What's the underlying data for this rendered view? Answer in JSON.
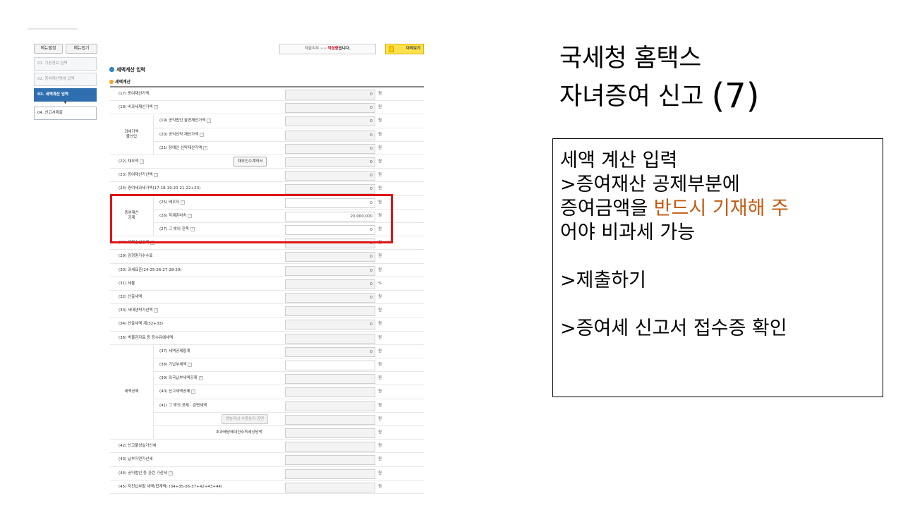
{
  "sidebar": {
    "menu_expand": "메뉴펼침",
    "menu_collapse": "메뉴접기",
    "steps": [
      {
        "label": "01. 기본정보 입력",
        "state": "done"
      },
      {
        "label": "02. 증여재산명세 입력",
        "state": "done"
      },
      {
        "label": "03. 세액계산 입력",
        "state": "active"
      },
      {
        "label": "04. 신고서제출",
        "state": "pending"
      }
    ]
  },
  "topbar": {
    "status_prefix": "제출여부 ›››› ",
    "status_value": "작성중",
    "status_suffix": "입니다.",
    "preview_button": "미리보기"
  },
  "section": {
    "title": "세액계산 입력",
    "subtitle": "세액계산"
  },
  "groups": {
    "g1": "과세가액\n불산입",
    "g2": "증여재산\n공제",
    "g3": "세액공제"
  },
  "rows": [
    {
      "label": "(17) 증여재산가액",
      "value": "0",
      "unit": "원"
    },
    {
      "label": "(18) 비과세재산가액",
      "value": "0",
      "unit": "원",
      "help": true
    },
    {
      "label": "(19) 공익법인 출연재산가액",
      "value": "0",
      "unit": "원",
      "help": true
    },
    {
      "label": "(20) 공익신탁 재산가액",
      "value": "0",
      "unit": "원",
      "help": true
    },
    {
      "label": "(21) 장애인 신탁재산가액",
      "value": "0",
      "unit": "원",
      "help": true
    },
    {
      "label": "(22) 채무액",
      "value": "0",
      "unit": "원",
      "help": true,
      "button": "채무인수계약서"
    },
    {
      "label": "(23) 증여재산가산액",
      "value": "0",
      "unit": "원",
      "help": true
    },
    {
      "label": "(24) 증여세과세가액(17-18-19-20-21-22+23)",
      "value": "0",
      "unit": "원"
    },
    {
      "label": "(25) 배우자",
      "value": "0",
      "unit": "원",
      "help": true
    },
    {
      "label": "(26) 직계존비속",
      "value": "20,000,000",
      "unit": "원",
      "help": true
    },
    {
      "label": "(27) 그 밖의 친족",
      "value": "0",
      "unit": "원",
      "help": true
    },
    {
      "label": "(28) 재해손실공제",
      "value": "0",
      "unit": "원",
      "help": true
    },
    {
      "label": "(29) 감정평가수수료",
      "value": "0",
      "unit": "원"
    },
    {
      "label": "(30) 과세표준(24-25-26-27-28-29)",
      "value": "0",
      "unit": "원"
    },
    {
      "label": "(31) 세율",
      "value": "0",
      "unit": "%"
    },
    {
      "label": "(32) 산출세액",
      "value": "0",
      "unit": "원"
    },
    {
      "label": "(33) 세대생략가산액",
      "value": "",
      "unit": "원",
      "help": true
    },
    {
      "label": "(34) 산출세액 계(32+33)",
      "value": "0",
      "unit": "원"
    },
    {
      "label": "(36) 박물관자료 등 징수유예세액",
      "value": "",
      "unit": "원"
    },
    {
      "label": "(37) 세액공제합계",
      "value": "0",
      "unit": "원"
    },
    {
      "label": "(38) 기납부세액",
      "value": "",
      "unit": "원",
      "help": true
    },
    {
      "label": "(39) 외국납부세액공제",
      "value": "",
      "unit": "원",
      "help": true
    },
    {
      "label": "(40) 신고세액공제",
      "value": "",
      "unit": "원",
      "help": true
    },
    {
      "label": "(41) 그 밖의 공제 · 감면세액",
      "value": "",
      "unit": "원"
    },
    {
      "label": "",
      "value": "",
      "unit": "원",
      "button": "영농자녀 수증농지 감면"
    },
    {
      "label": "초과배당에대한소득세상당액",
      "value": "",
      "unit": "원"
    },
    {
      "label": "(42) 신고불성실가산세",
      "value": "",
      "unit": "원"
    },
    {
      "label": "(43) 납부지연가산세",
      "value": "",
      "unit": "원"
    },
    {
      "label": "(44) 공익법인 등 관련 가산세",
      "value": "",
      "unit": "원",
      "help": true
    },
    {
      "label": "(45) 자진납부할 세액(합계액) (34+35-36-37+42+43+44)",
      "value": "",
      "unit": "원"
    }
  ],
  "panel": {
    "title_line1": "국세청 홈택스",
    "title_line2": "자녀증여 신고 ",
    "title_num": "(7)",
    "box_line1": "세액 계산 입력",
    "box_line2": ">증여재산 공제부분에",
    "box_line3a": "증여금액을 ",
    "box_line3b": "반드시 기재해 주",
    "box_line4": "어야 비과세 가능",
    "box_line5": ">제출하기",
    "box_line6": ">증여세 신고서 접수증 확인"
  }
}
